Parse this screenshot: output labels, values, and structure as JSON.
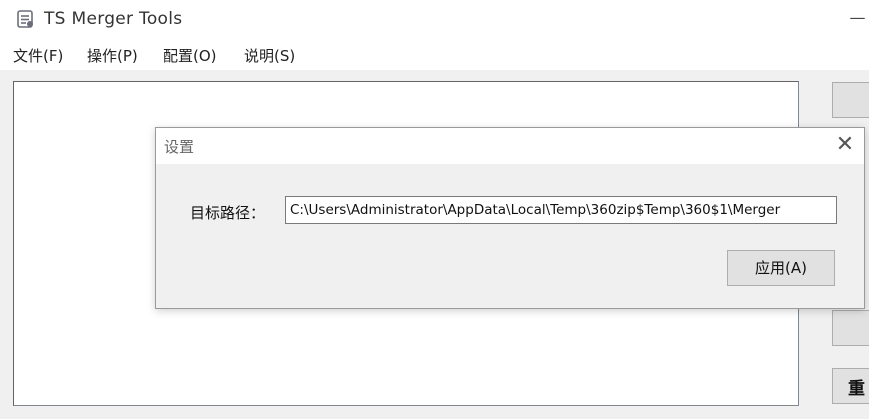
{
  "window": {
    "title": "TS Merger Tools",
    "minimize_glyph": "—"
  },
  "menu": {
    "items": [
      {
        "label": "文件(F)"
      },
      {
        "label": "操作(P)"
      },
      {
        "label": "配置(O)"
      },
      {
        "label": "说明(S)"
      }
    ]
  },
  "side_buttons": {
    "last_label": "重"
  },
  "dialog": {
    "title": "设置",
    "close_glyph": "✕",
    "path_label": "目标路径：",
    "path_value": "C:\\Users\\Administrator\\AppData\\Local\\Temp\\360zip$Temp\\360$1\\Merger",
    "apply_label": "应用(A)"
  },
  "icons": {
    "app": "app-logo-icon",
    "close": "close-icon"
  },
  "colors": {
    "window_bg": "#f0f0f0",
    "titlebar_bg": "#ffffff",
    "button_bg": "#e1e1e1",
    "button_border": "#adadad"
  }
}
